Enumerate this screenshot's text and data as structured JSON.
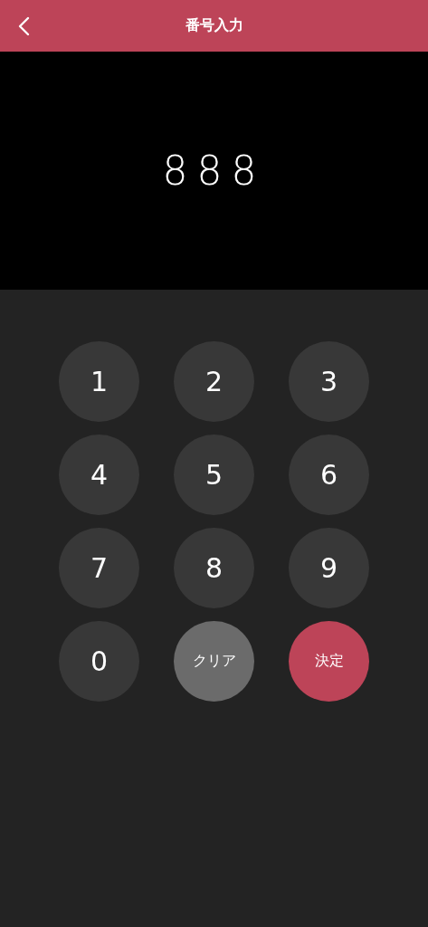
{
  "header": {
    "title": "番号入力"
  },
  "display": {
    "value": "888"
  },
  "keys": [
    {
      "label": "1",
      "kind": "digit"
    },
    {
      "label": "2",
      "kind": "digit"
    },
    {
      "label": "3",
      "kind": "digit"
    },
    {
      "label": "4",
      "kind": "digit"
    },
    {
      "label": "5",
      "kind": "digit"
    },
    {
      "label": "6",
      "kind": "digit"
    },
    {
      "label": "7",
      "kind": "digit"
    },
    {
      "label": "8",
      "kind": "digit"
    },
    {
      "label": "9",
      "kind": "digit"
    },
    {
      "label": "0",
      "kind": "digit"
    },
    {
      "label": "クリア",
      "kind": "clear"
    },
    {
      "label": "決定",
      "kind": "confirm"
    }
  ]
}
